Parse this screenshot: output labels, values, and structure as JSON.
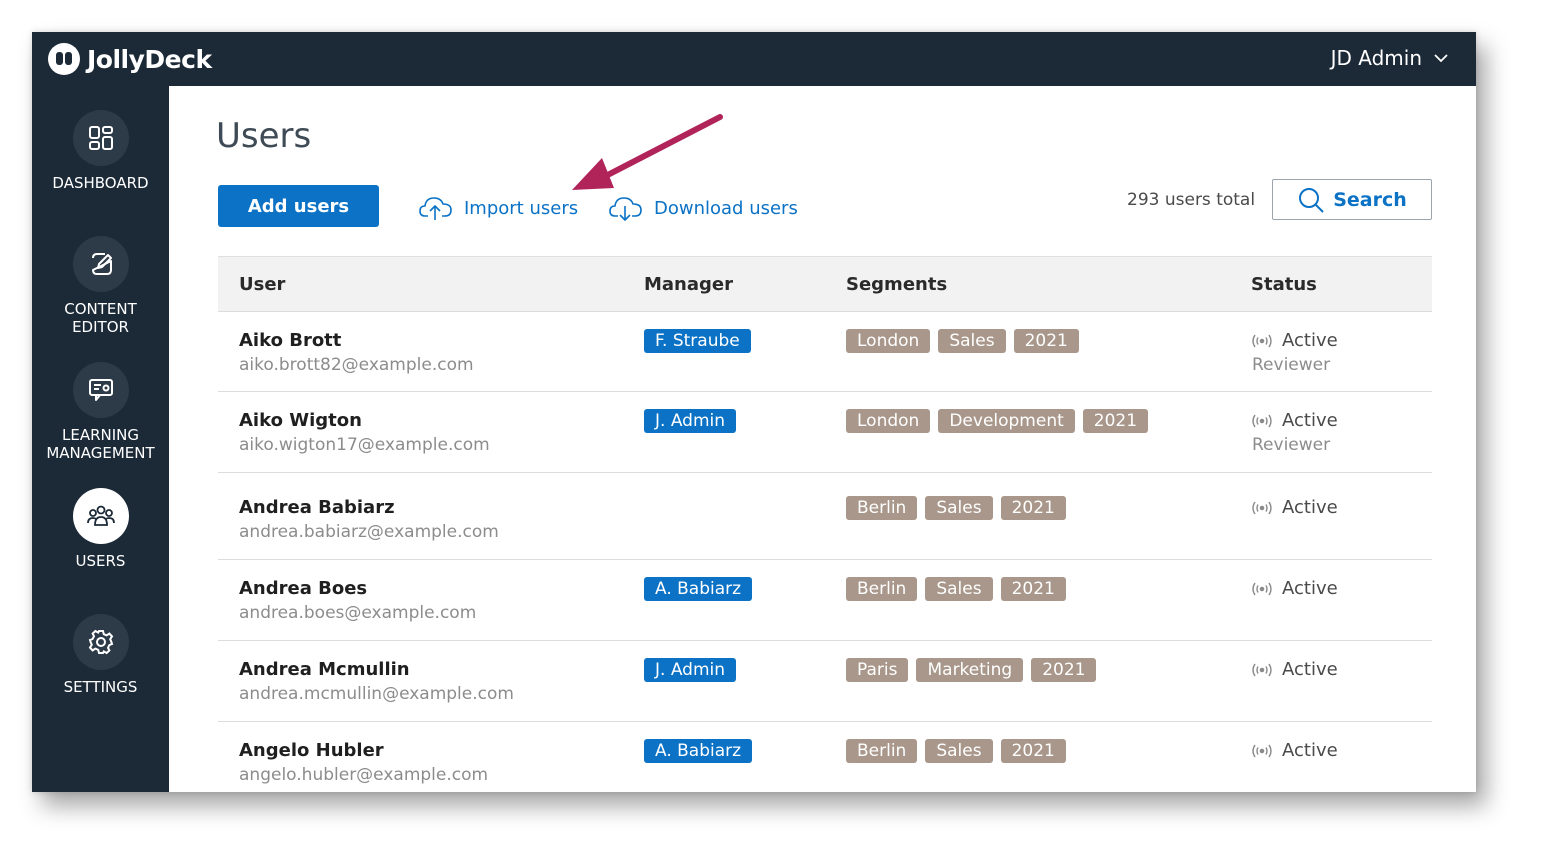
{
  "app": {
    "brand": "JollyDeck",
    "user_menu": "JD Admin"
  },
  "sidebar": {
    "items": [
      {
        "label": "DASHBOARD",
        "icon": "dashboard-grid-icon"
      },
      {
        "label": "CONTENT\nEDITOR",
        "icon": "edit-pencil-icon"
      },
      {
        "label": "LEARNING\nMANAGEMENT",
        "icon": "learning-icon"
      },
      {
        "label": "USERS",
        "icon": "users-icon",
        "active": true
      },
      {
        "label": "SETTINGS",
        "icon": "gear-icon"
      }
    ]
  },
  "main": {
    "title": "Users",
    "add_users": "Add users",
    "import_users": "Import users",
    "download_users": "Download users",
    "users_total": "293 users total",
    "search": "Search"
  },
  "table": {
    "columns": [
      "User",
      "Manager",
      "Segments",
      "Status"
    ],
    "rows": [
      {
        "name": "Aiko Brott",
        "email": "aiko.brott82@example.com",
        "manager": "F. Straube",
        "segments": [
          "London",
          "Sales",
          "2021"
        ],
        "status": "Active",
        "role": "Reviewer"
      },
      {
        "name": "Aiko Wigton",
        "email": "aiko.wigton17@example.com",
        "manager": "J. Admin",
        "segments": [
          "London",
          "Development",
          "2021"
        ],
        "status": "Active",
        "role": "Reviewer"
      },
      {
        "name": "Andrea Babiarz",
        "email": "andrea.babiarz@example.com",
        "manager": "",
        "segments": [
          "Berlin",
          "Sales",
          "2021"
        ],
        "status": "Active",
        "role": ""
      },
      {
        "name": "Andrea Boes",
        "email": "andrea.boes@example.com",
        "manager": "A. Babiarz",
        "segments": [
          "Berlin",
          "Sales",
          "2021"
        ],
        "status": "Active",
        "role": ""
      },
      {
        "name": "Andrea Mcmullin",
        "email": "andrea.mcmullin@example.com",
        "manager": "J. Admin",
        "segments": [
          "Paris",
          "Marketing",
          "2021"
        ],
        "status": "Active",
        "role": ""
      },
      {
        "name": "Angelo Hubler",
        "email": "angelo.hubler@example.com",
        "manager": "A. Babiarz",
        "segments": [
          "Berlin",
          "Sales",
          "2021"
        ],
        "status": "Active",
        "role": ""
      }
    ]
  },
  "colors": {
    "navy": "#1c2a38",
    "primary": "#0b72c6",
    "segment_tag": "#a8978a",
    "annotation_arrow": "#b0245a"
  }
}
